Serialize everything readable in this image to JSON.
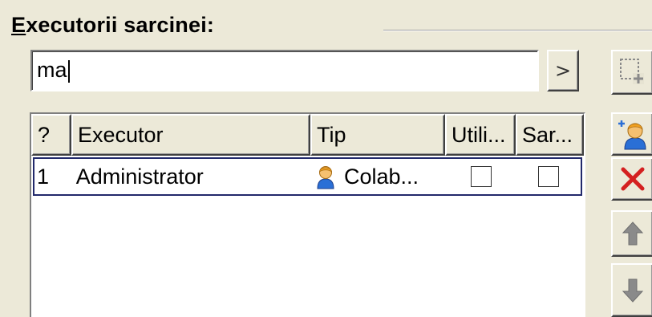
{
  "group": {
    "mnemonic": "E",
    "title_rest": "xecutorii sarcinei:"
  },
  "search": {
    "value": "ma",
    "go_label": ">"
  },
  "table": {
    "columns": [
      "?",
      "Executor",
      "Tip",
      "Utili...",
      "Sar..."
    ],
    "rows": [
      {
        "num": "1",
        "executor": "Administrator",
        "tip": "Colab...",
        "tip_icon": "user-icon",
        "utili_checked": false,
        "sar_checked": false
      }
    ]
  },
  "toolbar": {
    "icons": [
      "new-window-icon",
      "add-user-icon",
      "delete-icon",
      "arrow-up-icon",
      "arrow-down-icon"
    ]
  },
  "colors": {
    "background": "#ece9d8",
    "selection_border": "#22296b",
    "delete_red": "#d42020",
    "user_blue": "#2a6fd6",
    "user_orange": "#f0a020"
  }
}
